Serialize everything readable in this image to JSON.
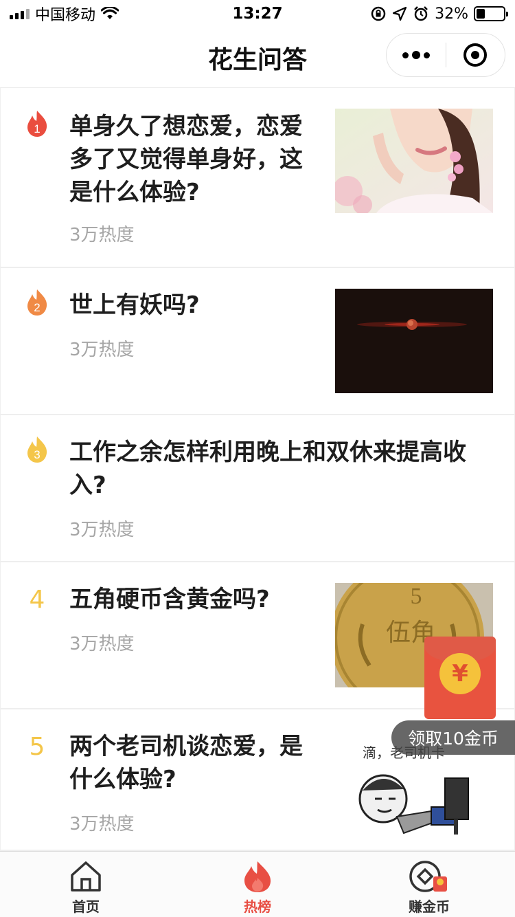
{
  "status_bar": {
    "carrier": "中国移动",
    "time": "13:27",
    "battery": "32%"
  },
  "nav": {
    "title": "花生问答"
  },
  "items": [
    {
      "rank": "1",
      "title_lines": [
        "单身久了想恋爱，恋爱",
        "多了又觉得单身好，这",
        "是什么体验?"
      ],
      "heat": "3万热度",
      "rank_color": "#ea4d3f"
    },
    {
      "rank": "2",
      "title_lines": [
        "世上有妖吗?"
      ],
      "heat": "3万热度",
      "rank_color": "#f08a45"
    },
    {
      "rank": "3",
      "title_lines": [
        "工作之余怎样利用晚上和双休来提高收",
        "入?"
      ],
      "heat": "3万热度",
      "rank_color": "#f4c64a"
    },
    {
      "rank": "4",
      "title_lines": [
        "五角硬币含黄金吗?"
      ],
      "heat": "3万热度"
    },
    {
      "rank": "5",
      "title_lines": [
        "两个老司机谈恋爱，是",
        "什么体验?"
      ],
      "heat": "3万热度"
    }
  ],
  "thumb_text": {
    "coin_digit": "5",
    "coin_word": "伍角",
    "meme_caption": "滴，老司机卡"
  },
  "red_packet": {
    "coin_symbol": "¥",
    "tip": "领取10金币"
  },
  "tab_bar": {
    "tabs": [
      {
        "label": "首页",
        "icon": "home-icon"
      },
      {
        "label": "热榜",
        "icon": "flame-icon"
      },
      {
        "label": "赚金币",
        "icon": "coin-icon"
      }
    ],
    "active": "热榜"
  },
  "colors": {
    "accent": "#e84f44",
    "rank_number": "#f4c64a",
    "muted_text": "#a6a6a6"
  }
}
